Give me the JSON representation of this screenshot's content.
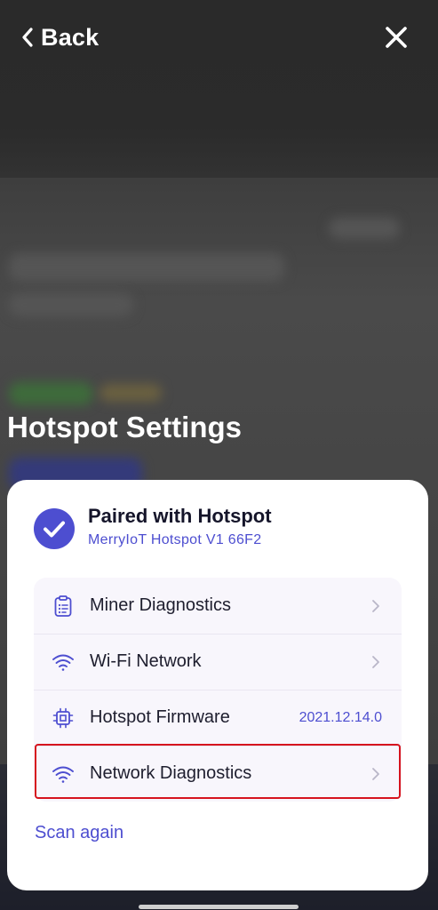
{
  "header": {
    "back_label": "Back",
    "back_icon": "chevron-left-icon",
    "close_icon": "close-icon"
  },
  "screen_title": "Hotspot Settings",
  "card": {
    "status": {
      "title": "Paired with Hotspot",
      "device_name": "MerryIoT Hotspot V1 66F2",
      "icon": "check-circle-icon",
      "accent_color": "#4d4ed0"
    },
    "menu": [
      {
        "label": "Miner Diagnostics",
        "icon": "clipboard-icon",
        "chevron": true
      },
      {
        "label": "Wi-Fi Network",
        "icon": "wifi-icon",
        "chevron": true
      },
      {
        "label": "Hotspot Firmware",
        "icon": "chip-icon",
        "value": "2021.12.14.0"
      },
      {
        "label": "Network Diagnostics",
        "icon": "wifi-icon",
        "chevron": true,
        "highlighted": true
      }
    ],
    "scan_again_label": "Scan again"
  },
  "colors": {
    "accent": "#4d4ed0",
    "highlight_border": "#d6141e",
    "card_background": "#ffffff",
    "menu_background": "#f8f6fc"
  }
}
